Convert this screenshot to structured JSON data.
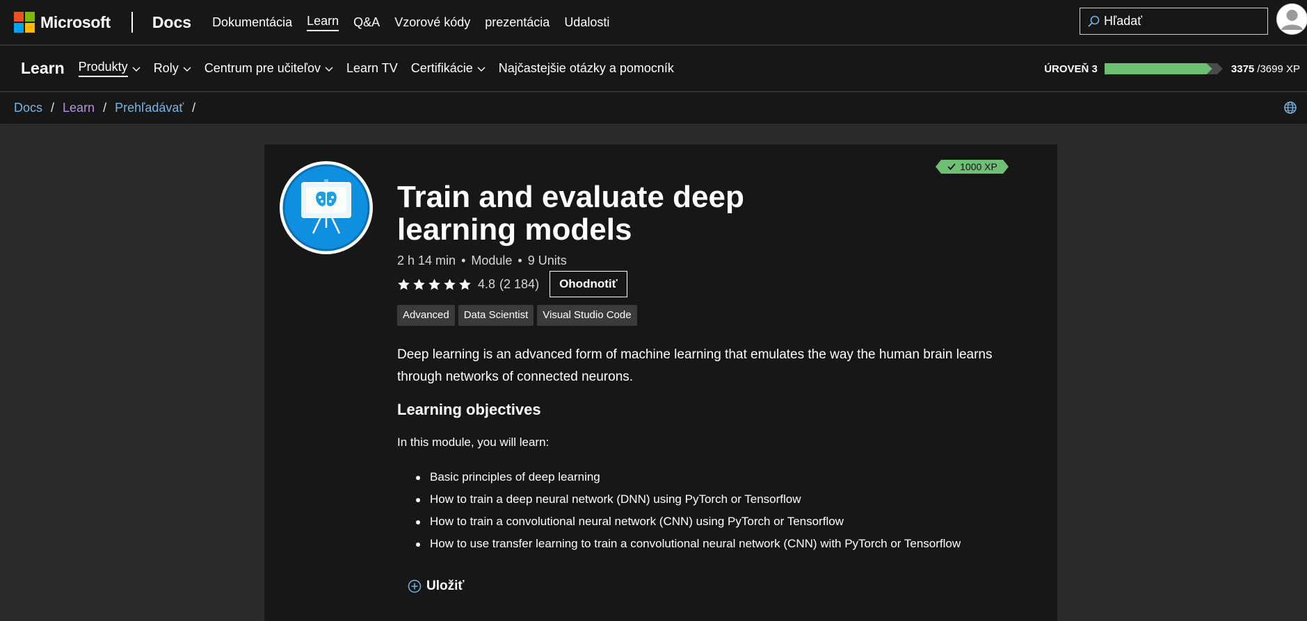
{
  "header": {
    "brand": "Microsoft",
    "product": "Docs",
    "nav": [
      {
        "label": "Dokumentácia"
      },
      {
        "label": "Learn"
      },
      {
        "label": "Q&A"
      },
      {
        "label": "Vzorové kódy"
      },
      {
        "label": "prezentácia"
      },
      {
        "label": "Udalosti"
      }
    ],
    "active_nav": "Learn",
    "search_placeholder": "Hľadať"
  },
  "learn_nav": {
    "brand": "Learn",
    "items": [
      {
        "label": "Produkty",
        "dropdown": true
      },
      {
        "label": "Roly",
        "dropdown": true
      },
      {
        "label": "Centrum pre učiteľov",
        "dropdown": true
      },
      {
        "label": "Learn TV",
        "dropdown": false
      },
      {
        "label": "Certifikácie",
        "dropdown": true
      },
      {
        "label": "Najčastejšie otázky a pomocník",
        "dropdown": false
      }
    ],
    "level_label": "ÚROVEŇ 3",
    "xp_current": "3375",
    "xp_total": "/3699 XP",
    "level_progress": 0.91
  },
  "breadcrumb": {
    "items": [
      "Docs",
      "Learn",
      "Prehľadávať"
    ],
    "separator": "/"
  },
  "module": {
    "xp_badge": "1000 XP",
    "title": "Train and evaluate deep learning models",
    "duration": "2 h 14 min",
    "type": "Module",
    "units": "9 Units",
    "meta_separator": "•",
    "rating_value": "4.8",
    "rating_count": "(2 184)",
    "stars": 5,
    "rate_button": "Ohodnotiť",
    "tags": [
      "Advanced",
      "Data Scientist",
      "Visual Studio Code"
    ],
    "description": "Deep learning is an advanced form of machine learning that emulates the way the human brain learns through networks of connected neurons.",
    "objectives_heading": "Learning objectives",
    "objectives_intro": "In this module, you will learn:",
    "objectives": [
      "Basic principles of deep learning",
      "How to train a deep neural network (DNN) using PyTorch or Tensorflow",
      "How to train a convolutional neural network (CNN) using PyTorch or Tensorflow",
      "How to use transfer learning to train a convolutional neural network (CNN) with PyTorch or Tensorflow"
    ],
    "save_button": "Uložiť"
  },
  "colors": {
    "accent_link": "#75b6e7",
    "visited_link": "#b98de3",
    "xp_green": "#6dbf72",
    "icon_blue": "#0e8fe0"
  },
  "icons": [
    "search-icon",
    "user-avatar-icon",
    "chevron-down-icon",
    "globe-icon",
    "check-icon",
    "star-icon",
    "add-circle-icon",
    "module-presentation-icon"
  ]
}
